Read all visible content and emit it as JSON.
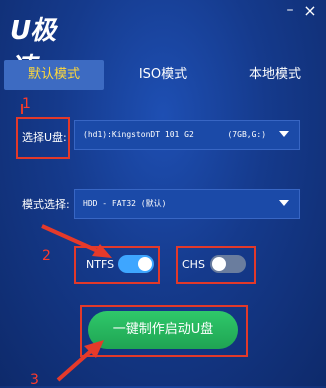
{
  "app": {
    "logo_text": "U极速"
  },
  "window": {
    "minimize_symbol": "–",
    "close_symbol": "×"
  },
  "tabs": [
    {
      "label": "默认模式",
      "active": true
    },
    {
      "label": "ISO模式",
      "active": false
    },
    {
      "label": "本地模式",
      "active": false
    }
  ],
  "annotations": {
    "step1": "1",
    "step2": "2",
    "step3": "3",
    "color": "#e53a2a"
  },
  "disk_select": {
    "label": "选择U盘:",
    "value": "(hd1):KingstonDT 101 G2       (7GB,G:)"
  },
  "mode_select": {
    "label": "模式选择:",
    "value": "HDD - FAT32 (默认)"
  },
  "toggles": {
    "ntfs": {
      "label": "NTFS",
      "on": true
    },
    "chs": {
      "label": "CHS",
      "on": false
    }
  },
  "start_button": {
    "label": "一键制作启动U盘"
  },
  "colors": {
    "accent": "#ffd93a",
    "button": "#22b35c",
    "toggle_on": "#3ea6ff",
    "background": "#153a8c"
  }
}
